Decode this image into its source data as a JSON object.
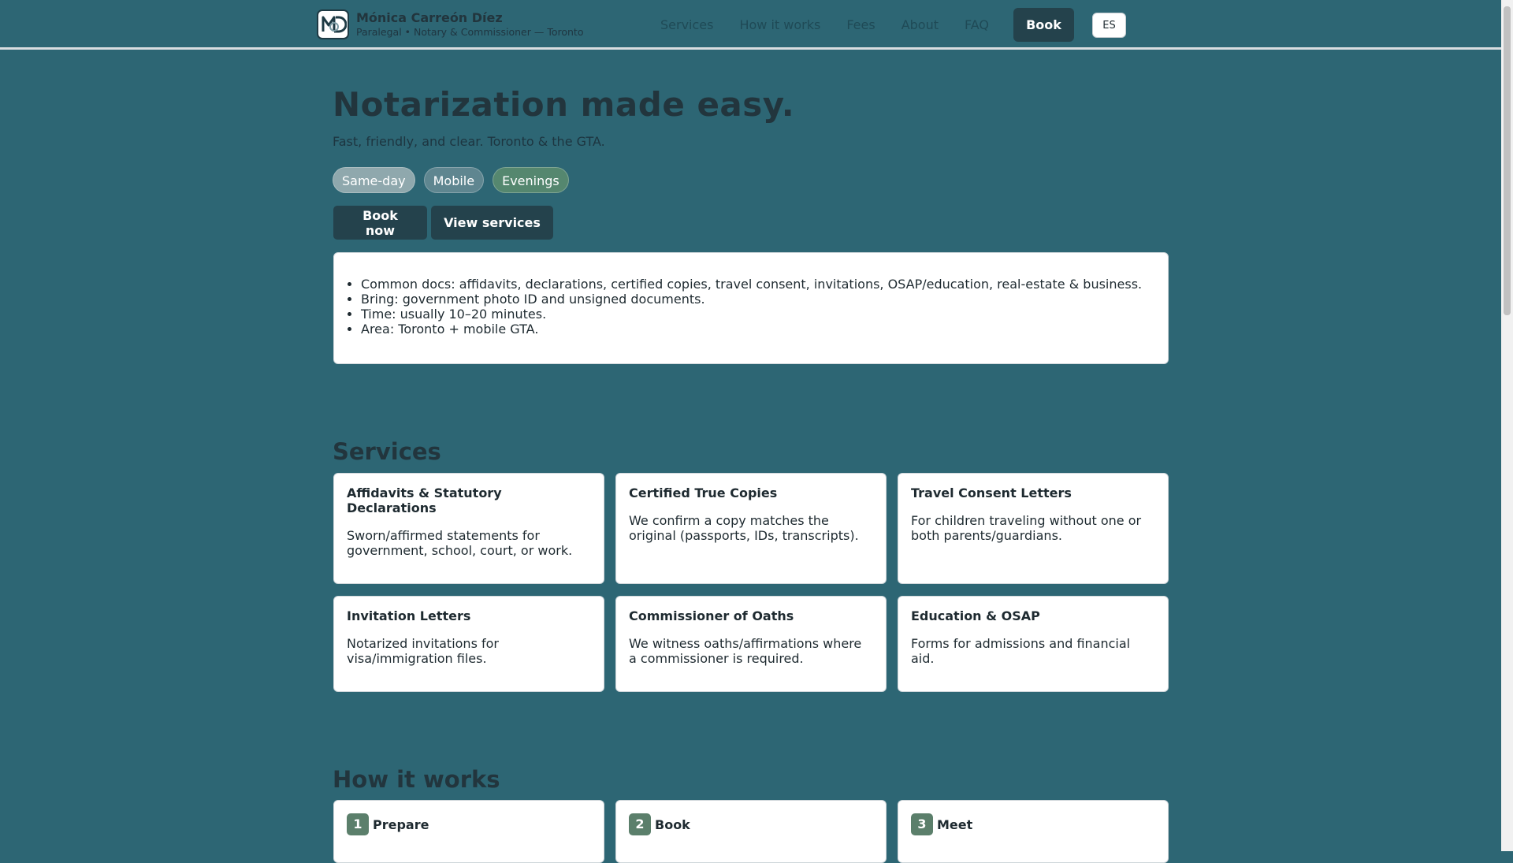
{
  "header": {
    "brand_name": "Mónica Carreón Díez",
    "brand_sub": "Paralegal • Notary & Commissioner — Toronto",
    "logo_monogram": "MD",
    "nav": [
      "Services",
      "How it works",
      "Fees",
      "About",
      "FAQ"
    ],
    "book_label": "Book",
    "lang_label": "ES"
  },
  "hero": {
    "title": "Notarization made easy.",
    "subtitle": "Fast, friendly, and clear. Toronto & the GTA.",
    "chips": [
      "Same-day",
      "Mobile",
      "Evenings"
    ],
    "cta_primary": "Book now",
    "cta_secondary": "View services",
    "info": [
      "Common docs: affidavits, declarations, certified copies, travel consent, invitations, OSAP/education, real-estate & business.",
      "Bring: government photo ID and unsigned documents.",
      "Time: usually 10–20 minutes.",
      "Area: Toronto + mobile GTA."
    ]
  },
  "services": {
    "title": "Services",
    "items": [
      {
        "title": "Affidavits & Statutory Declarations",
        "desc": "Sworn/affirmed statements for government, school, court, or work."
      },
      {
        "title": "Certified True Copies",
        "desc": "We confirm a copy matches the original (passports, IDs, transcripts)."
      },
      {
        "title": "Travel Consent Letters",
        "desc": "For children traveling without one or both parents/guardians."
      },
      {
        "title": "Invitation Letters",
        "desc": "Notarized invitations for visa/immigration files."
      },
      {
        "title": "Commissioner of Oaths",
        "desc": "We witness oaths/affirmations where a commissioner is required."
      },
      {
        "title": "Education & OSAP",
        "desc": "Forms for admissions and financial aid."
      }
    ]
  },
  "how": {
    "title": "How it works",
    "steps": [
      {
        "num": "1",
        "title": "Prepare"
      },
      {
        "num": "2",
        "title": "Book"
      },
      {
        "num": "3",
        "title": "Meet"
      }
    ]
  },
  "colors": {
    "background": "#2d6674",
    "dark_button": "#24424c",
    "step_badge": "#5b7f6b"
  }
}
